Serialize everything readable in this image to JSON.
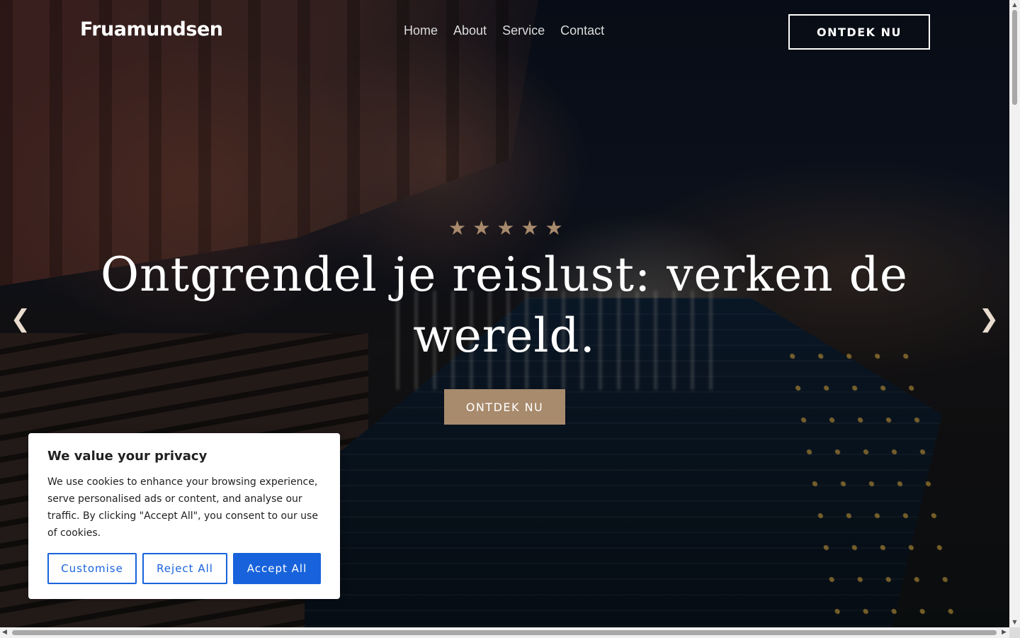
{
  "header": {
    "logo": "Fruamundsen",
    "nav": [
      "Home",
      "About",
      "Service",
      "Contact"
    ],
    "cta_label": "ONTDEK NU"
  },
  "hero": {
    "rating_stars": 5,
    "headline": "Ontgrendel je reislust: verken de wereld.",
    "cta_label": "ONTDEK NU",
    "prev_icon": "chevron-left-icon",
    "next_icon": "chevron-right-icon",
    "accent_color": "#a88a6c"
  },
  "cookie_banner": {
    "title": "We value your privacy",
    "body": "We use cookies to enhance your browsing experience, serve personalised ads or content, and analyse our traffic. By clicking \"Accept All\", you consent to our use of cookies.",
    "customise_label": "Customise",
    "reject_label": "Reject All",
    "accept_label": "Accept All",
    "button_color": "#1863dc"
  }
}
